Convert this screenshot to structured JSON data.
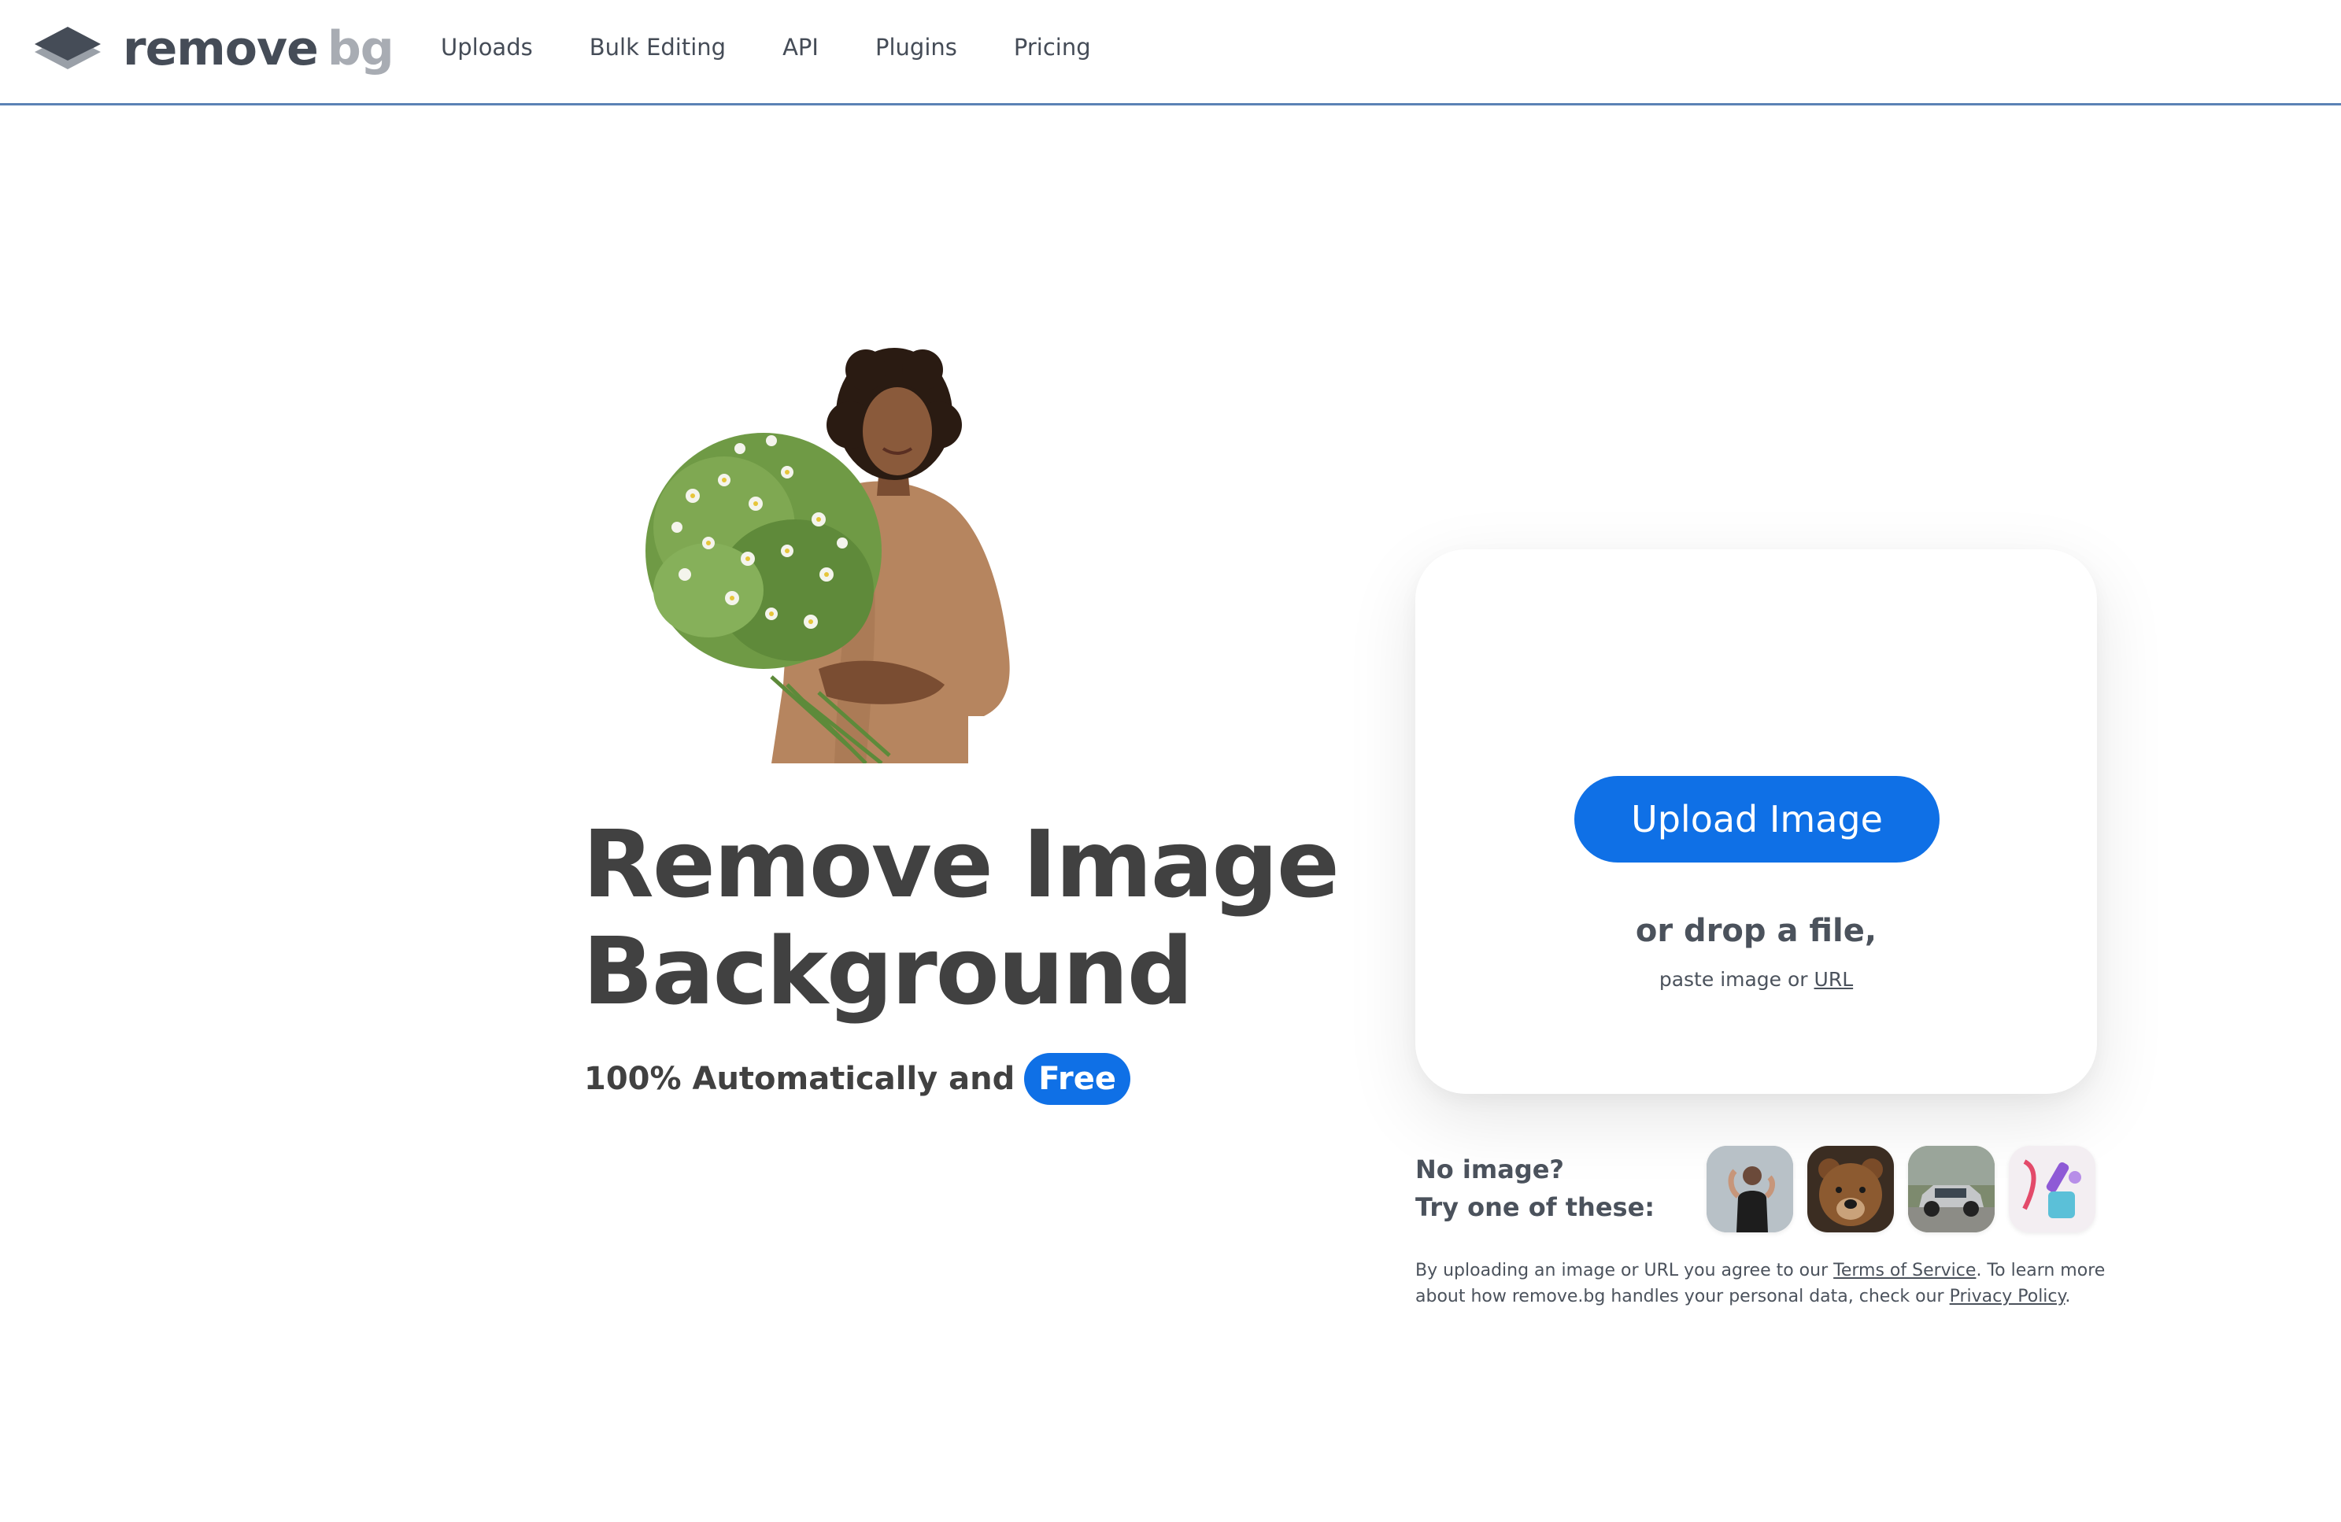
{
  "header": {
    "logo": {
      "primary": "remove",
      "secondary": "bg"
    },
    "nav": [
      {
        "label": "Uploads"
      },
      {
        "label": "Bulk Editing"
      },
      {
        "label": "API"
      },
      {
        "label": "Plugins"
      },
      {
        "label": "Pricing"
      }
    ]
  },
  "hero": {
    "title_line1": "Remove Image",
    "title_line2": "Background",
    "subtitle": "100% Automatically and",
    "badge": "Free"
  },
  "upload": {
    "button_label": "Upload Image",
    "drop_text": "or drop a file,",
    "paste_prefix": "paste image or",
    "paste_link": "URL"
  },
  "samples": {
    "label_line1": "No image?",
    "label_line2": "Try one of these:",
    "items": [
      {
        "icon": "sample-person-image"
      },
      {
        "icon": "sample-bear-image"
      },
      {
        "icon": "sample-car-image"
      },
      {
        "icon": "sample-objects-image"
      }
    ]
  },
  "legal": {
    "prefix": "By uploading an image or URL you agree to our",
    "tos_link": "Terms of Service",
    "middle": ". To learn more about how remove.bg handles your personal data, check our",
    "privacy_link": "Privacy Policy",
    "suffix": "."
  },
  "colors": {
    "accent": "#0f70e6",
    "text": "#454c57",
    "header_rule": "#5b82b5"
  }
}
